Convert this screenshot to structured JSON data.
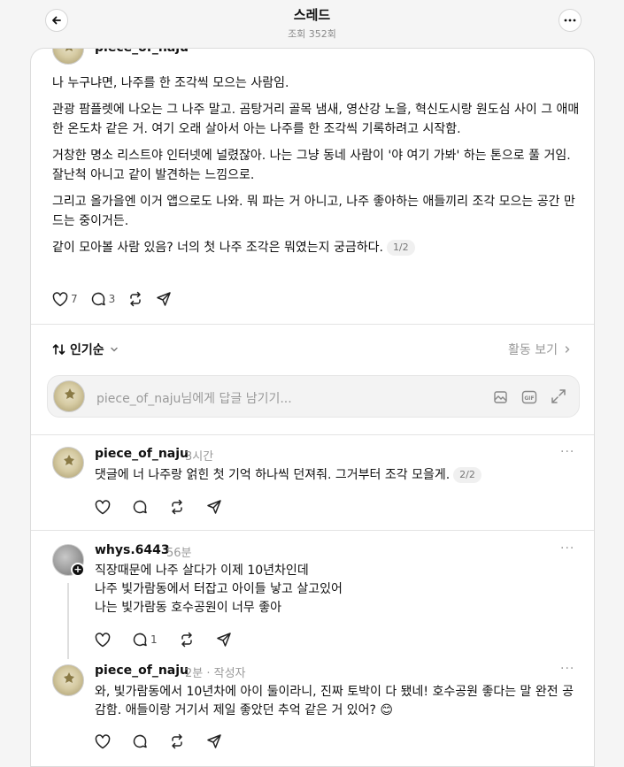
{
  "header": {
    "title": "스레드",
    "views": "조회 352회"
  },
  "post": {
    "username": "piece_of_naju",
    "paragraphs": [
      "나 누구냐면, 나주를 한 조각씩 모으는 사람임.",
      "관광 팜플렛에 나오는 그 나주 말고. 곰탕거리 골목 냄새, 영산강 노을, 혁신도시랑 원도심 사이 그 애매한 온도차 같은 거. 여기 오래 살아서 아는 나주를 한 조각씩 기록하려고 시작함.",
      "거창한 명소 리스트야 인터넷에 널렸잖아. 나는 그냥 동네 사람이 '야 여기 가봐' 하는 톤으로 풀 거임. 잘난척 아니고 같이 발견하는 느낌으로.",
      "그리고 올가을엔 이거 앱으로도 나와. 뭐 파는 거 아니고, 나주 좋아하는 애들끼리 조각 모으는 공간 만드는 중이거든."
    ],
    "last_paragraph": "같이 모아볼 사람 있음? 너의 첫 나주 조각은 뭐였는지 궁금하다.",
    "page_indicator": "1/2",
    "likes": "7",
    "comments": "3"
  },
  "sort": {
    "label": "인기순",
    "activity_link": "활동 보기"
  },
  "reply_box": {
    "username_placeholder": "piece_of_naju",
    "placeholder_suffix": "님에게 답글 남기기..."
  },
  "comments": [
    {
      "username": "piece_of_naju",
      "time": "3시간",
      "text": "댓글에 너 나주랑 얽힌 첫 기억 하나씩 던져줘. 그거부터 조각 모을게.",
      "page_indicator": "2/2"
    },
    {
      "username": "whys.6443",
      "time": "56분",
      "lines": [
        "직장때문에 나주 살다가 이제 10년차인데",
        "나주 빛가람동에서 터잡고 아이들 낳고 살고있어",
        "나는 빛가람동 호수공원이 너무 좋아"
      ],
      "comment_count": "1"
    },
    {
      "username": "piece_of_naju",
      "time": "2분",
      "author_tag": "· 작성자",
      "text": "와, 빛가람동에서 10년차에 아이 둘이라니, 진짜 토박이 다 됐네! 호수공원 좋다는 말 완전 공감함. 애들이랑 거기서 제일 좋았던 추억 같은 거 있어?",
      "emoji": "😊"
    }
  ],
  "icons": [
    "arrow-left-icon",
    "more-horizontal-icon",
    "heart-icon",
    "comment-icon",
    "repost-icon",
    "share-icon",
    "sort-icon",
    "chevron-down-icon",
    "chevron-right-icon",
    "image-icon",
    "gif-icon",
    "expand-icon",
    "plus-icon"
  ],
  "colors": {
    "text": "#101010",
    "muted": "#999999",
    "background": "#f5f5f5",
    "card": "#ffffff"
  }
}
